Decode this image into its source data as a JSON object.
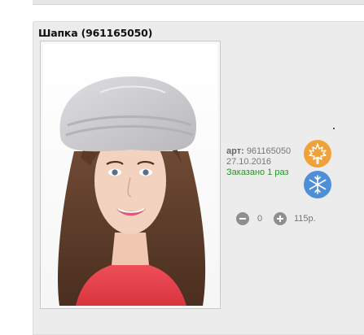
{
  "product": {
    "title": "Шапка (961165050)",
    "article_label": "арт:",
    "article_value": "961165050",
    "date": "27.10.2016",
    "ordered": "Заказано 1 раз",
    "quantity": "0",
    "price": "115р."
  },
  "badges": [
    {
      "icon": "maple-leaf-icon",
      "season": "autumn",
      "color": "#f0a23a"
    },
    {
      "icon": "snowflake-icon",
      "season": "winter",
      "color": "#4f8fd8"
    }
  ],
  "colors": {
    "ordered_text": "#1f9a1f",
    "hat": "#c9c8cc",
    "sweater": "#e8424a"
  }
}
